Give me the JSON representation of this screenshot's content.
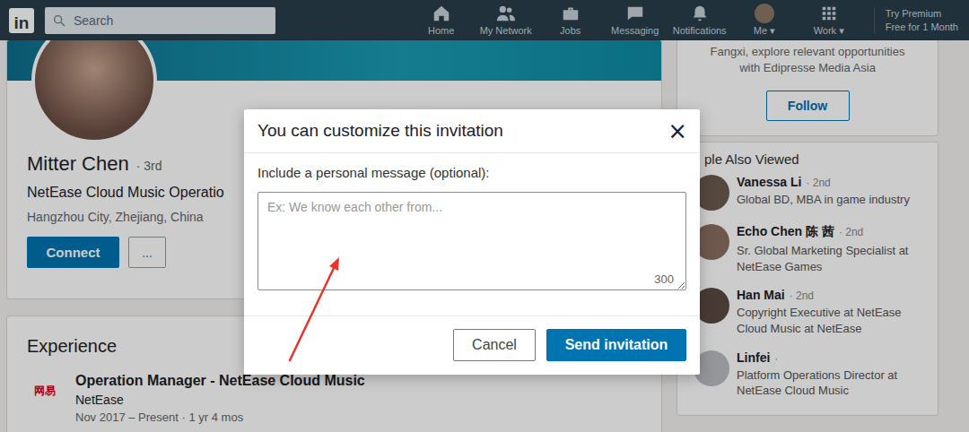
{
  "nav": {
    "logo": "in",
    "search": {
      "placeholder": "Search"
    },
    "items": [
      {
        "label": "Home"
      },
      {
        "label": "My Network"
      },
      {
        "label": "Jobs"
      },
      {
        "label": "Messaging"
      },
      {
        "label": "Notifications"
      },
      {
        "label": "Me ▾"
      },
      {
        "label": "Work ▾"
      }
    ],
    "premium": [
      "Try Premium",
      "Free for 1 Month"
    ]
  },
  "profile": {
    "name": "Mitter Chen",
    "degree": "· 3rd",
    "headline": "NetEase Cloud Music Operatio",
    "location": "Hangzhou City, Zhejiang, China",
    "connect": "Connect",
    "more": "..."
  },
  "experience": {
    "title": "Experience",
    "items": [
      {
        "logo": "网易",
        "role": "Operation Manager - NetEase Cloud Music",
        "company": "NetEase",
        "dates": "Nov 2017 – Present · 1 yr 4 mos"
      }
    ]
  },
  "promo": {
    "lines": [
      "Fangxi, explore relevant opportunities",
      "with Edipresse Media Asia"
    ],
    "button": "Follow"
  },
  "people_also_viewed": {
    "title": "ple Also Viewed",
    "people": [
      {
        "name": "Vanessa Li",
        "degree": "· 2nd",
        "headline": "Global BD, MBA in game industry"
      },
      {
        "name": "Echo Chen 陈 茜",
        "degree": "· 2nd",
        "headline": "Sr. Global Marketing Specialist at NetEase Games"
      },
      {
        "name": "Han Mai",
        "degree": "· 2nd",
        "headline": "Copyright Executive at NetEase Cloud Music at NetEase"
      },
      {
        "name": "Linfei",
        "degree": "·",
        "headline": "Platform Operations Director at NetEase Cloud Music"
      }
    ]
  },
  "dialog": {
    "title": "You can customize this invitation",
    "close": "×",
    "label": "Include a personal message (optional):",
    "placeholder": "Ex: We know each other from...",
    "counter": "300",
    "buttons": [
      {
        "label": "Cancel",
        "primary": false
      },
      {
        "label": "Send invitation",
        "primary": true
      }
    ]
  }
}
